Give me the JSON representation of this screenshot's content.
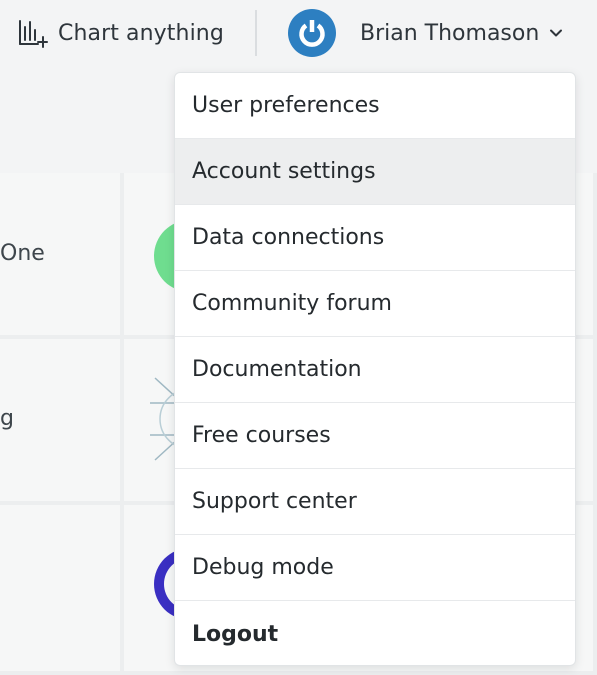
{
  "header": {
    "chart_button": {
      "label": "Chart anything",
      "icon": "chart-add-icon"
    },
    "user": {
      "name": "Brian Thomason",
      "avatar_icon": "power-icon",
      "avatar_color": "#2d7fc1",
      "chevron_icon": "chevron-down-icon"
    }
  },
  "background_items": [
    {
      "text": "One"
    },
    {
      "text": "g"
    }
  ],
  "user_menu": {
    "items": [
      {
        "label": "User preferences"
      },
      {
        "label": "Account settings",
        "state": "hovered"
      },
      {
        "label": "Data connections"
      },
      {
        "label": "Community forum"
      },
      {
        "label": "Documentation"
      },
      {
        "label": "Free courses"
      },
      {
        "label": "Support center"
      },
      {
        "label": "Debug mode"
      },
      {
        "label": "Logout",
        "emphasis": "bold"
      }
    ]
  }
}
